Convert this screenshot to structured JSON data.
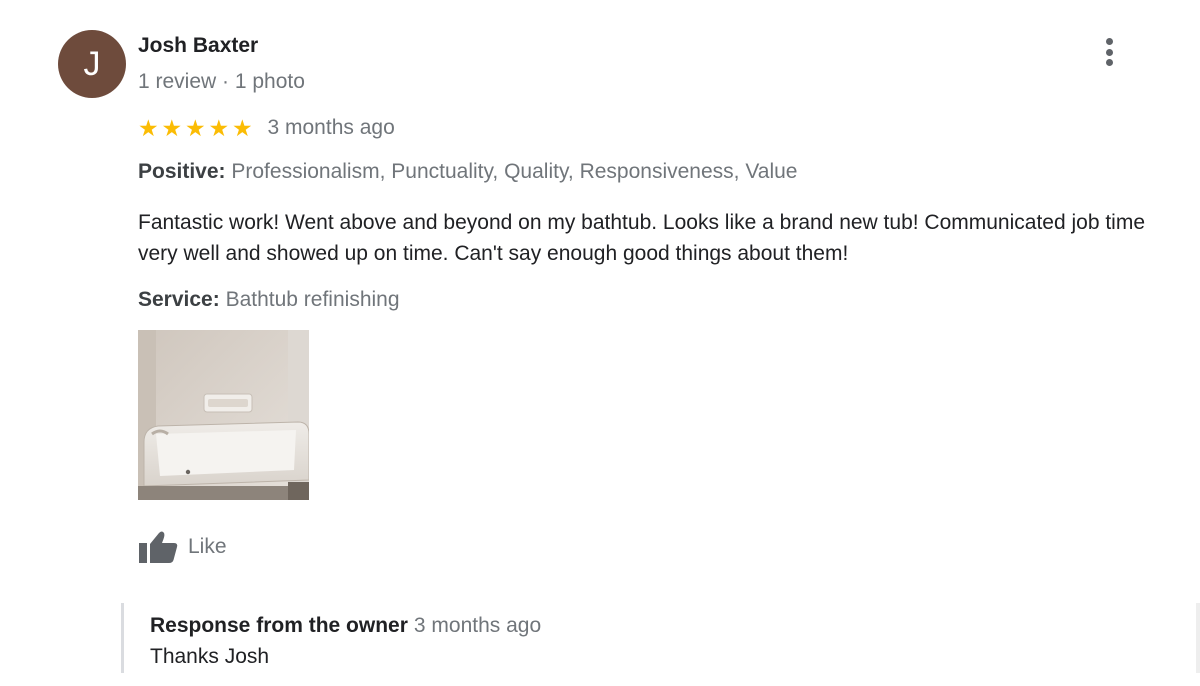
{
  "reviewer": {
    "initial": "J",
    "name": "Josh Baxter",
    "meta": "1 review · 1 photo",
    "avatar_color": "#6e4b3c"
  },
  "more_options_icon": "vertical-dots-icon",
  "review": {
    "rating": 5,
    "rating_max": 5,
    "star_color": "#fbbc04",
    "date": "3 months ago",
    "positive_label": "Positive:",
    "positive_value": "Professionalism, Punctuality, Quality, Responsiveness, Value",
    "text": "Fantastic work! Went above and beyond on my bathtub. Looks like a brand new tub! Communicated job time very well and showed up on time. Can't say enough good things about them!",
    "service_label": "Service:",
    "service_value": "Bathtub refinishing"
  },
  "like": {
    "icon": "thumbs-up-icon",
    "label": "Like"
  },
  "owner_response": {
    "title": "Response from the owner",
    "date": "3 months ago",
    "text": "Thanks Josh"
  }
}
